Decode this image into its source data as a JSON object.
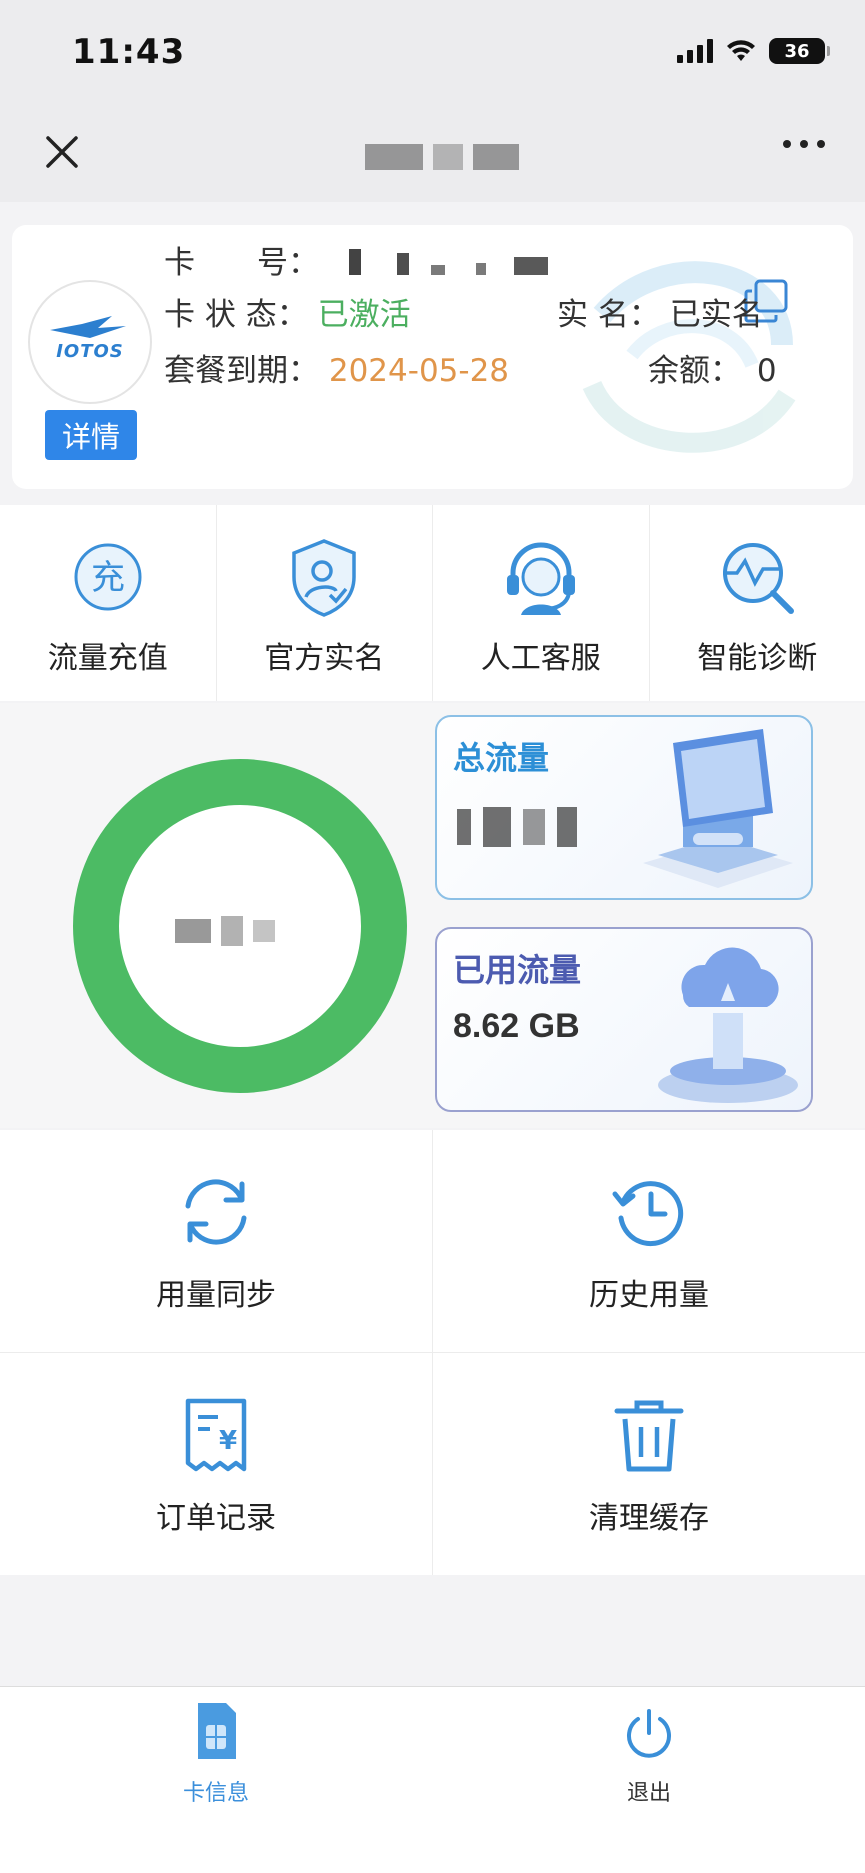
{
  "status_bar": {
    "time": "11:43",
    "battery": "36"
  },
  "nav": {
    "close_icon": "close-icon",
    "more_icon": "more-icon"
  },
  "card": {
    "logo_text": "IOTOS",
    "detail_label": "详情",
    "number_label": "卡　　号：",
    "status_label": "卡 状 态：",
    "status_value": "已激活",
    "realname_label": "实 名：",
    "realname_value": "已实名",
    "expiry_label": "套餐到期：",
    "expiry_value": "2024-05-28",
    "balance_label": "余额：",
    "balance_value": "0",
    "colors": {
      "status": "#4caf60",
      "expiry": "#e0954a"
    }
  },
  "quick_actions": [
    {
      "label": "流量充值",
      "icon": "recharge-icon"
    },
    {
      "label": "官方实名",
      "icon": "realname-shield-icon"
    },
    {
      "label": "人工客服",
      "icon": "customer-service-icon"
    },
    {
      "label": "智能诊断",
      "icon": "diagnosis-icon"
    }
  ],
  "traffic": {
    "ring_color": "#4cbb64",
    "total_title": "总流量",
    "used_title": "已用流量",
    "used_value": "8.62 GB"
  },
  "tools": [
    {
      "label": "用量同步",
      "icon": "sync-icon"
    },
    {
      "label": "历史用量",
      "icon": "history-icon"
    },
    {
      "label": "订单记录",
      "icon": "order-receipt-icon"
    },
    {
      "label": "清理缓存",
      "icon": "trash-icon"
    }
  ],
  "tabs": [
    {
      "label": "卡信息",
      "icon": "sim-card-icon",
      "active": true
    },
    {
      "label": "退出",
      "icon": "power-icon",
      "active": false
    }
  ]
}
